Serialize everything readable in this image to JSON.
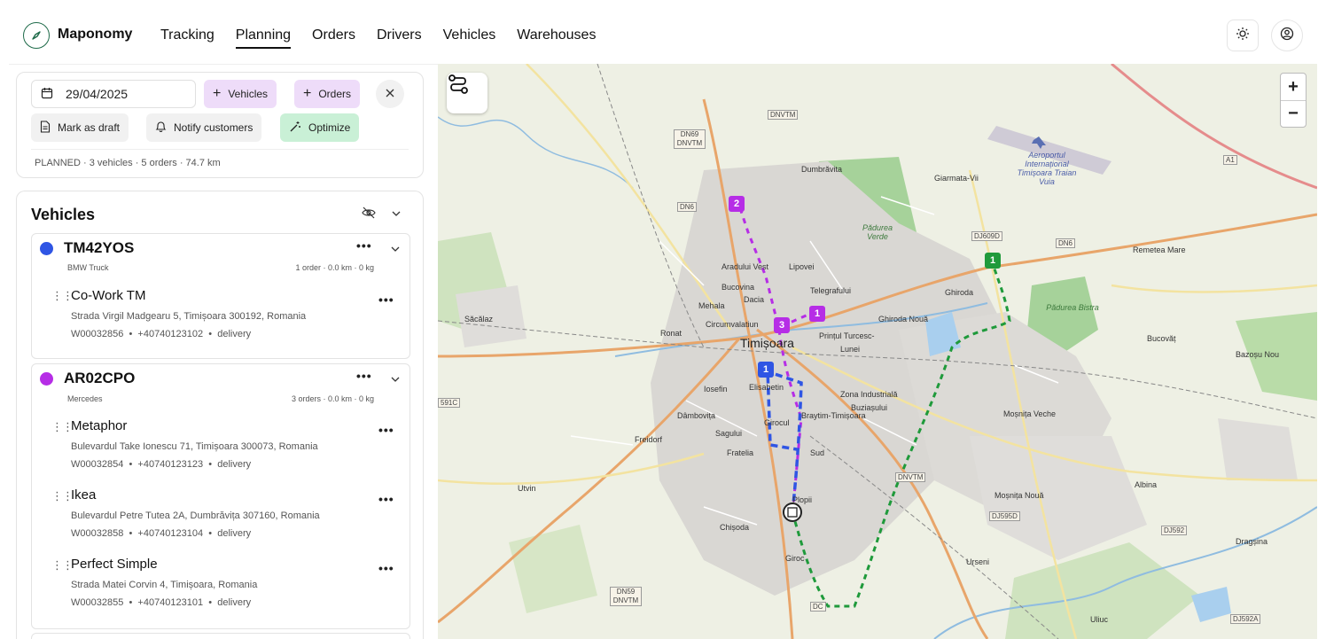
{
  "app": {
    "name": "Maponomy"
  },
  "nav": {
    "items": [
      "Tracking",
      "Planning",
      "Orders",
      "Drivers",
      "Vehicles",
      "Warehouses"
    ],
    "active": "Planning"
  },
  "toolbar": {
    "date": "29/04/2025",
    "vehicles_label": "Vehicles",
    "orders_label": "Orders",
    "mark_draft_label": "Mark as draft",
    "notify_label": "Notify customers",
    "optimize_label": "Optimize",
    "summary": "PLANNED · 3 vehicles · 5 orders · 74.7 km"
  },
  "vehicles_section": {
    "title": "Vehicles",
    "vehicles": [
      {
        "plate": "TM42YOS",
        "type": "BMW Truck",
        "meta": "1 order · 0.0 km · 0 kg",
        "color": "#2f55e4",
        "stops": [
          {
            "name": "Co-Work TM",
            "address": "Strada Virgil Madgearu 5, Timișoara 300192, Romania",
            "order": "W00032856",
            "phone": "+40740123102",
            "kind": "delivery"
          }
        ]
      },
      {
        "plate": "AR02CPO",
        "type": "Mercedes",
        "meta": "3 orders · 0.0 km · 0 kg",
        "color": "#b62de6",
        "stops": [
          {
            "name": "Metaphor",
            "address": "Bulevardul Take Ionescu 71, Timișoara 300073, Romania",
            "order": "W00032854",
            "phone": "+40740123123",
            "kind": "delivery"
          },
          {
            "name": "Ikea",
            "address": "Bulevardul Petre Tutea 2A, Dumbrăvița 307160, Romania",
            "order": "W00032858",
            "phone": "+40740123104",
            "kind": "delivery"
          },
          {
            "name": "Perfect Simple",
            "address": "Strada Matei Corvin 4, Timișoara, Romania",
            "order": "W00032855",
            "phone": "+40740123101",
            "kind": "delivery"
          }
        ]
      }
    ]
  },
  "map": {
    "labels": {
      "city": "Timișoara",
      "dumbravita": "Dumbrăvita",
      "giarmata": "Giarmata-Vii",
      "aradului": "Aradului Vest",
      "lipovei": "Lipovei",
      "bucovina": "Bucovina",
      "telegrafului": "Telegrafului",
      "mehala": "Mehala",
      "dacia": "Dacia",
      "circumvalatiunii": "Circumvalatiun",
      "printul": "Prințul Turcesc-",
      "lunei": "Lunei",
      "ghiroda_noua": "Ghiroda Nouă",
      "ghiroda": "Ghiroda",
      "ronat": "Ronat",
      "sacalaz": "Săcălaz",
      "iosefin": "Iosefin",
      "elisabetin": "Elisabetin",
      "zona": "Zona Industrială",
      "buziasului": "Buziașului",
      "dambovita": "Dâmbovița",
      "freidorf": "Freidorf",
      "sagului": "Sagului",
      "giroc": "Girocul",
      "braytim": "Braytim-Timișoara",
      "sud": "Sud",
      "fratelia": "Fratelia",
      "plopi": "Plopii",
      "chisoda": "Chișoda",
      "giroc2": "Giroc",
      "utvin": "Utvin",
      "urseni": "Urseni",
      "mosnita_veche": "Moșnița Veche",
      "mosnita_noua": "Moșnița Nouă",
      "albina": "Albina",
      "bucovat": "Bucovăț",
      "bazosu": "Bazoșu Nou",
      "remetea": "Remetea Mare",
      "dragsina": "Dragșina",
      "uliuc": "Uliuc",
      "padurea_verde": "Pădurea Verde",
      "padurea_bistra": "Pădurea Bistra",
      "aeroport": "Aeroportul Internațional Timișoara Traian Vuia"
    },
    "road_tags": [
      "DNVTM",
      "DN69 DNVTM",
      "DN6",
      "DJ609D",
      "DN6",
      "A1",
      "591C",
      "DNVTM",
      "DJ595D",
      "DJ592",
      "DN59 DNVTM",
      "DC",
      "DJ592A"
    ],
    "pins": [
      {
        "label": "2",
        "color": "#b62de6"
      },
      {
        "label": "3",
        "color": "#b62de6"
      },
      {
        "label": "1",
        "color": "#b62de6"
      },
      {
        "label": "1",
        "color": "#2f55e4"
      },
      {
        "label": "1",
        "color": "#1f9a3b"
      }
    ],
    "zoom_in": "+",
    "zoom_out": "−"
  }
}
